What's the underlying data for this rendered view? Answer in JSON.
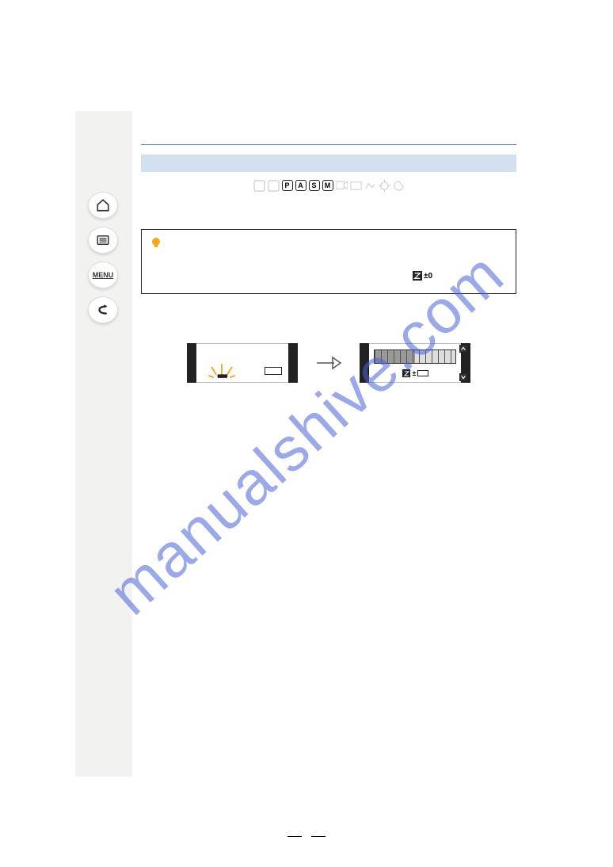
{
  "watermark": "manualshive.com",
  "nav": {
    "home": "home-icon",
    "contents": "contents-icon",
    "menu_label": "MENU",
    "back": "back-icon"
  },
  "modes": {
    "letters": [
      "P",
      "A",
      "S",
      "M"
    ]
  },
  "tip": {
    "indicator_prefix": "±",
    "indicator_value": "0"
  },
  "figures": {
    "fig2_indicator_prefix": "±"
  },
  "page_number": ""
}
